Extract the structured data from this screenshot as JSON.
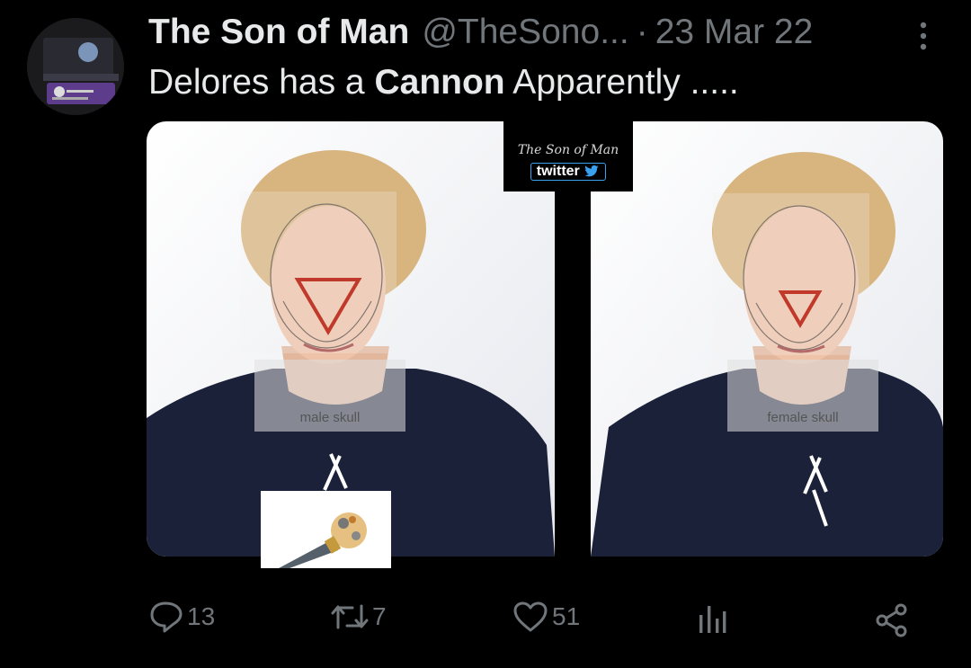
{
  "tweet": {
    "author_name": "The Son of Man",
    "handle": "@TheSono...",
    "separator": "·",
    "date": "23 Mar 22",
    "text_part1": "Delores has a ",
    "text_bold": "Cannon",
    "text_part2": " Apparently .....",
    "media": {
      "watermark_line1": "The Son of Man",
      "watermark_line2": "twitter",
      "left_label": "male skull",
      "right_label": "female skull"
    },
    "actions": {
      "replies": "13",
      "retweets": "7",
      "likes": "51"
    }
  },
  "colors": {
    "background": "#000000",
    "text_primary": "#e7e9ea",
    "text_secondary": "#71767b",
    "triangle": "#c0392b",
    "shirt": "#1a2138"
  },
  "icons": {
    "more": "more-vertical-icon",
    "reply": "reply-icon",
    "retweet": "retweet-icon",
    "like": "heart-icon",
    "views": "bar-chart-icon",
    "share": "share-icon"
  }
}
